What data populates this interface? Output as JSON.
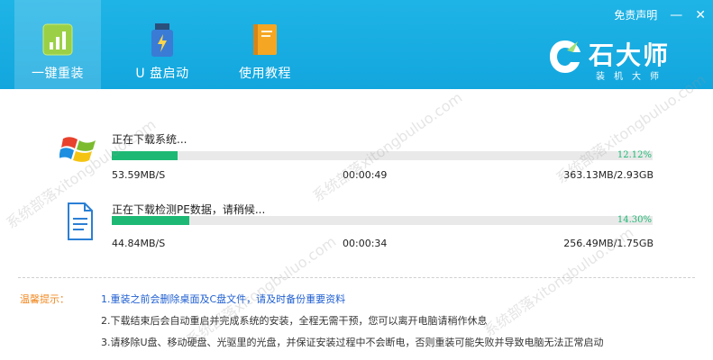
{
  "header": {
    "nav": [
      {
        "label": "一键重装",
        "icon": "bar-chart-icon",
        "active": true
      },
      {
        "label": "U 盘启动",
        "icon": "usb-flash-icon",
        "active": false
      },
      {
        "label": "使用教程",
        "icon": "book-icon",
        "active": false
      }
    ],
    "disclaimer": "免责声明",
    "minimize_icon": "minimize-icon",
    "close_icon": "close-icon",
    "brand_name": "石大师",
    "brand_sub": "装机大师"
  },
  "downloads": [
    {
      "title": "正在下载系统...",
      "icon": "windows-logo-icon",
      "percent": 12.12,
      "percent_text": "12.12%",
      "speed": "53.59MB/S",
      "time": "00:00:49",
      "size": "363.13MB/2.93GB"
    },
    {
      "title": "正在下载检测PE数据，请稍候...",
      "icon": "document-icon",
      "percent": 14.3,
      "percent_text": "14.30%",
      "speed": "44.84MB/S",
      "time": "00:00:34",
      "size": "256.49MB/1.75GB"
    }
  ],
  "tips": {
    "label": "温馨提示：",
    "lines": [
      "1.重装之前会删除桌面及C盘文件，请及时备份重要资料",
      "2.下载结束后会自动重启并完成系统的安装，全程无需干预，您可以离开电脑请稍作休息",
      "3.请移除U盘、移动硬盘、光驱里的光盘，并保证安装过程中不会断电，否则重装可能失败并导致电脑无法正常启动"
    ]
  },
  "colors": {
    "header_bg": "#15a9e0",
    "progress": "#1db974",
    "tips_label": "#f08a24",
    "tips_first": "#1f5fd1"
  },
  "watermark": "系统部落xitongbuluo.com"
}
